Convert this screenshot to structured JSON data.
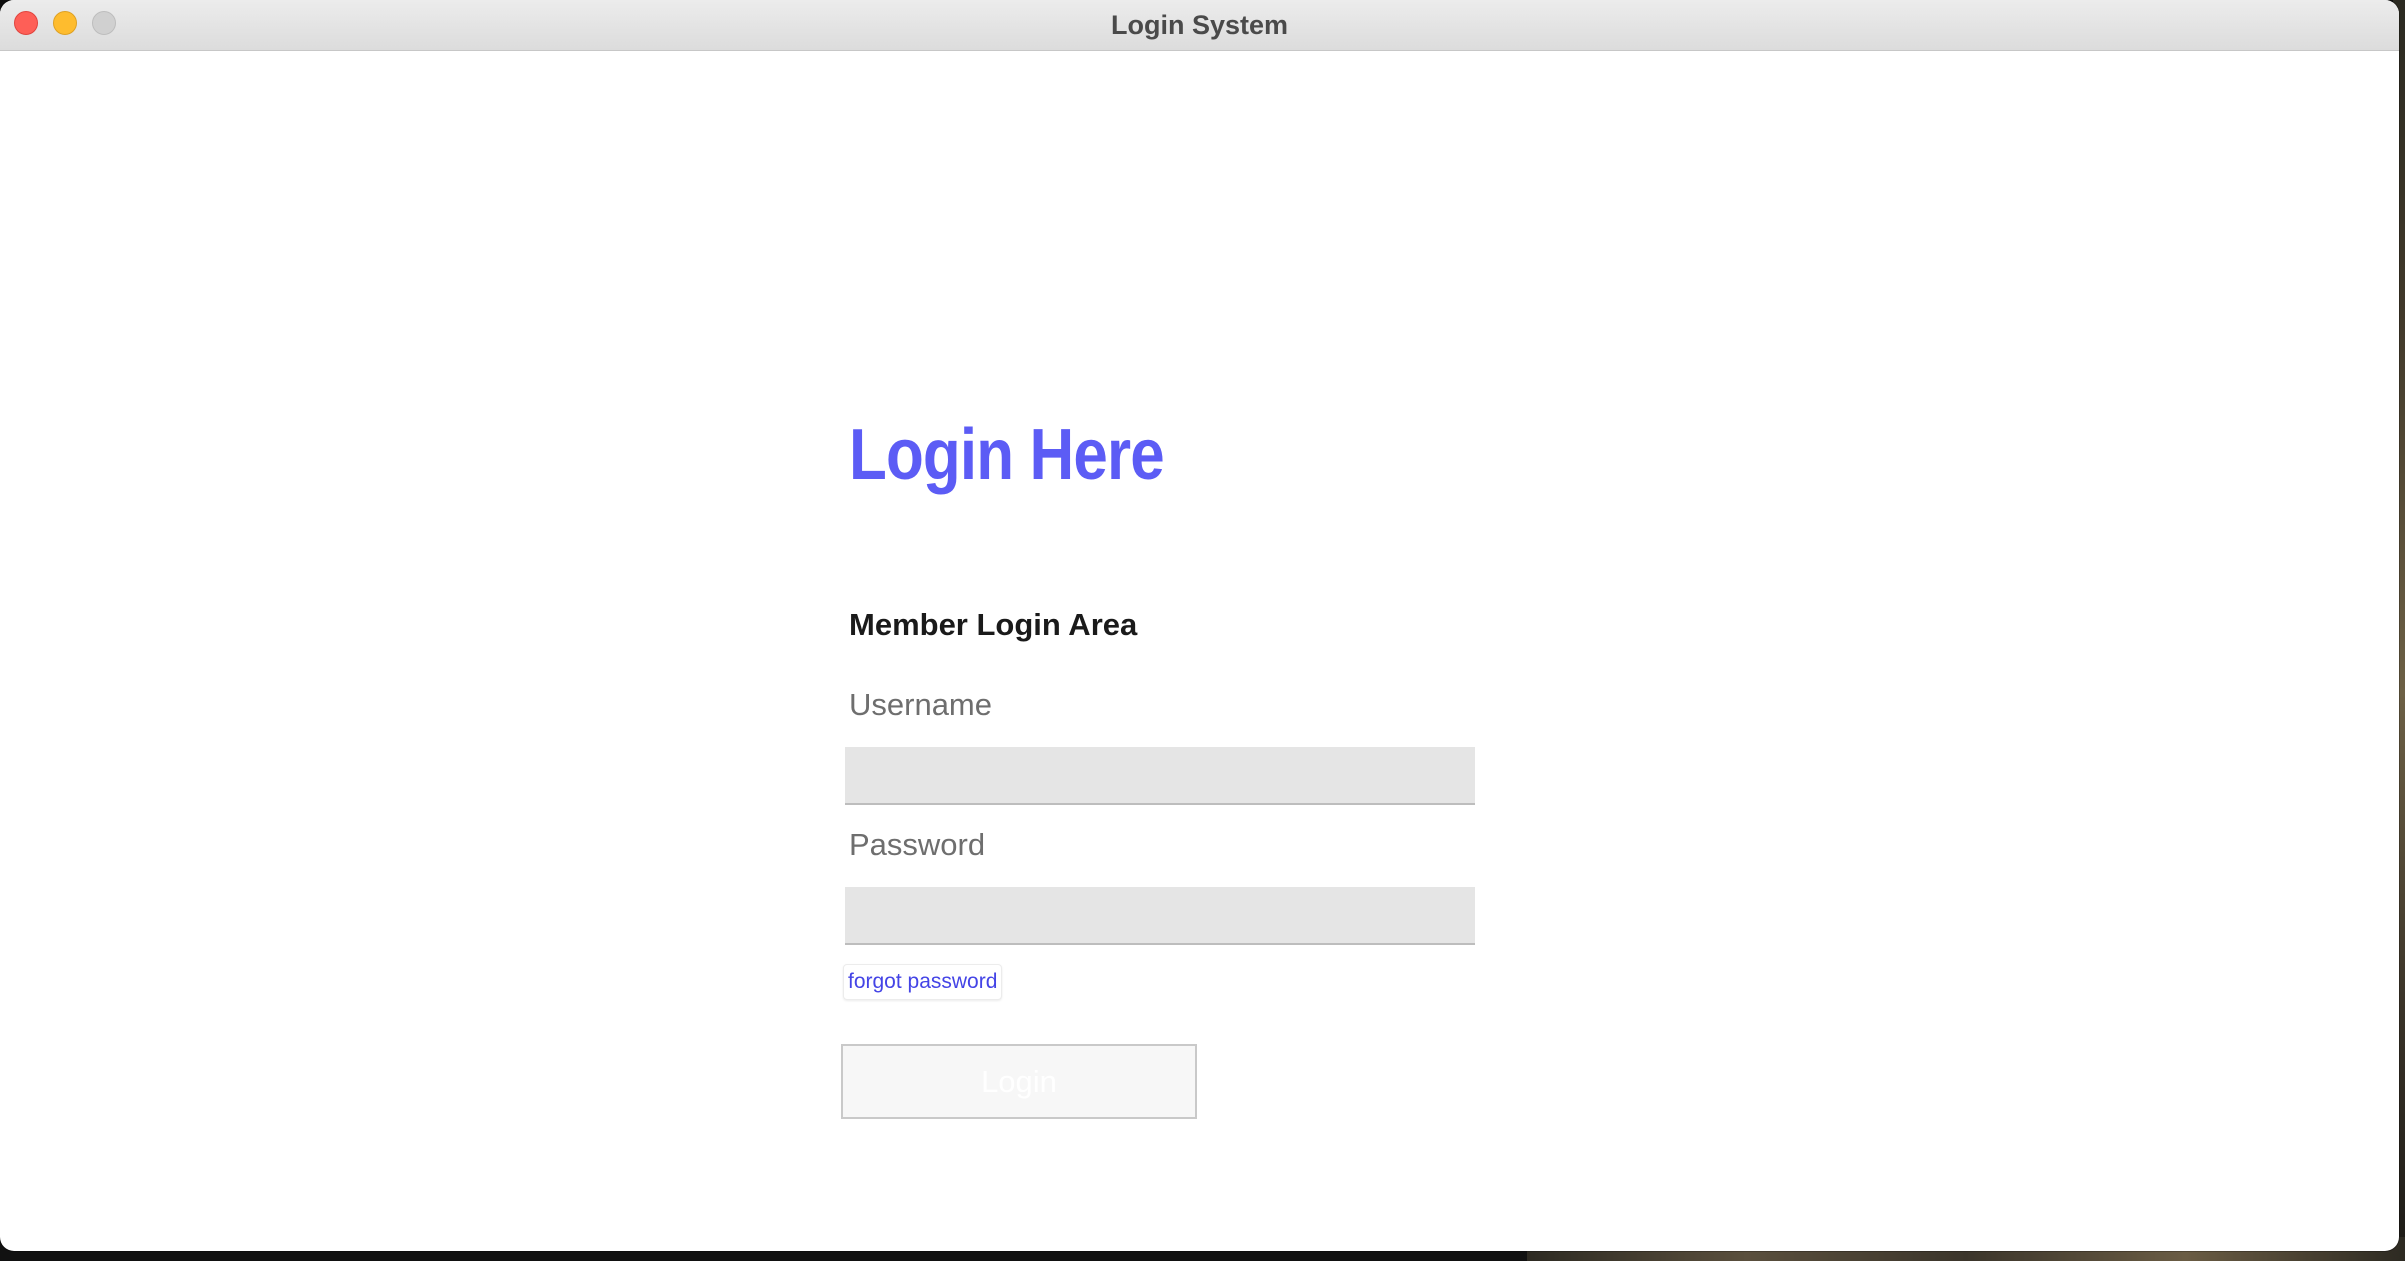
{
  "window": {
    "title": "Login System"
  },
  "form": {
    "heading": "Login Here",
    "subheading": "Member Login Area",
    "username_label": "Username",
    "username_value": "",
    "password_label": "Password",
    "password_value": "",
    "forgot_link": "forgot password",
    "login_button": "Login"
  },
  "colors": {
    "heading": "#5c5cf5",
    "link": "#4444e6",
    "input_bg": "#e5e5e5",
    "close": "#fe5f57",
    "minimize": "#febc2e",
    "maximize": "#d0d0d0"
  }
}
